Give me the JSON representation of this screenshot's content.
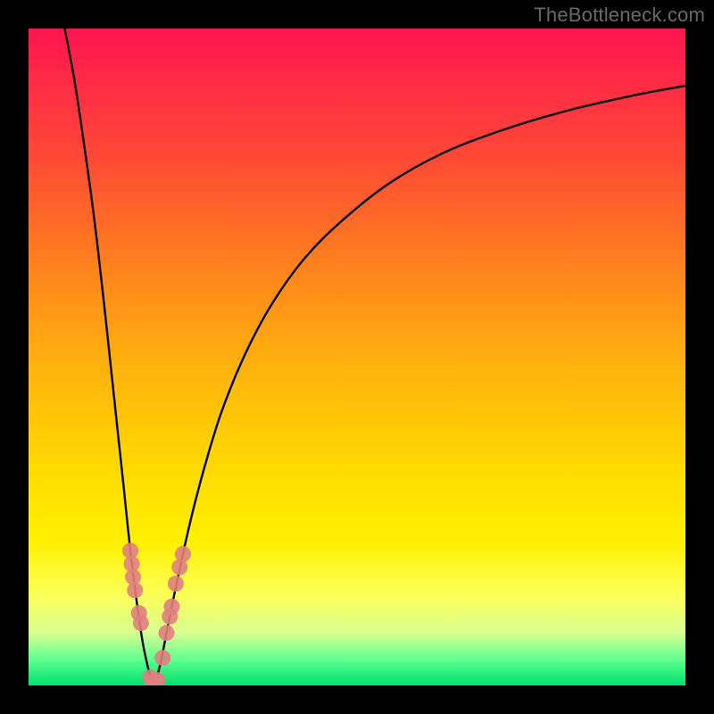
{
  "watermark": "TheBottleneck.com",
  "chart_data": {
    "type": "line",
    "title": "",
    "xlabel": "",
    "ylabel": "",
    "xlim": [
      0,
      100
    ],
    "ylim": [
      0,
      100
    ],
    "series": [
      {
        "name": "left-curve",
        "x": [
          5.5,
          7,
          8.5,
          10,
          11.5,
          13,
          14.5,
          15.5,
          16.5,
          17.3,
          18,
          18.6,
          19.1
        ],
        "y": [
          100,
          92,
          82,
          71,
          58,
          44,
          30,
          20.5,
          12.5,
          7,
          3.5,
          1.2,
          0
        ]
      },
      {
        "name": "right-curve",
        "x": [
          19.1,
          20,
          21,
          22,
          23.5,
          25,
          27,
          29.5,
          33,
          37,
          42,
          48,
          55,
          63,
          72,
          82,
          92,
          100
        ],
        "y": [
          0,
          3,
          8,
          13,
          20,
          26.5,
          34,
          42,
          50.5,
          58,
          65,
          71,
          76.5,
          81,
          84.5,
          87.5,
          89.8,
          91.3
        ]
      },
      {
        "name": "confidence-markers",
        "x": [
          15.5,
          15.7,
          15.9,
          16.2,
          16.8,
          17.1,
          18.5,
          19.0,
          19.6,
          20.4,
          21.0,
          21.5,
          21.8,
          22.4,
          23.0,
          23.5
        ],
        "y": [
          20.5,
          18.5,
          16.5,
          14.5,
          11,
          9.5,
          1.2,
          0.5,
          0.8,
          4.2,
          8,
          10.5,
          12,
          15.5,
          18,
          20
        ]
      }
    ],
    "gradient_stops": [
      {
        "pos": 0.0,
        "color": "#ff1450"
      },
      {
        "pos": 0.34,
        "color": "#ff7a20"
      },
      {
        "pos": 0.78,
        "color": "#fff000"
      },
      {
        "pos": 1.0,
        "color": "#00e070"
      }
    ]
  }
}
